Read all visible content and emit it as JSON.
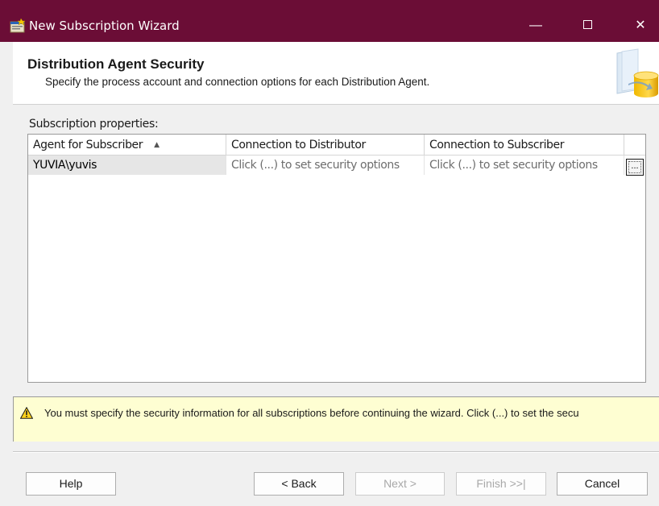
{
  "window": {
    "title": "New Subscription Wizard",
    "titlebar_color": "#6b0d36",
    "controls": {
      "minimize": "—",
      "close": "✕"
    }
  },
  "header": {
    "title": "Distribution Agent Security",
    "subtitle": "Specify the process account and connection options for each Distribution Agent."
  },
  "subscriptions": {
    "label": "Subscription properties:",
    "columns": [
      "Agent for Subscriber",
      "Connection to Distributor",
      "Connection to Subscriber"
    ],
    "sort": {
      "column": "Agent for Subscriber",
      "direction": "ascending",
      "indicator": "▲"
    },
    "rows": [
      {
        "agent": "YUVIA\\yuvis",
        "distributor": "Click (...) to set security options",
        "subscriber": "Click (...) to set security options",
        "button": "..."
      }
    ]
  },
  "warning": {
    "icon": "warning-triangle-icon",
    "text": "You must specify the security information for all subscriptions before continuing the wizard. Click (...) to set the secu"
  },
  "buttons": {
    "help": "Help",
    "back": "< Back",
    "next": "Next >",
    "finish": "Finish >>|",
    "cancel": "Cancel"
  }
}
